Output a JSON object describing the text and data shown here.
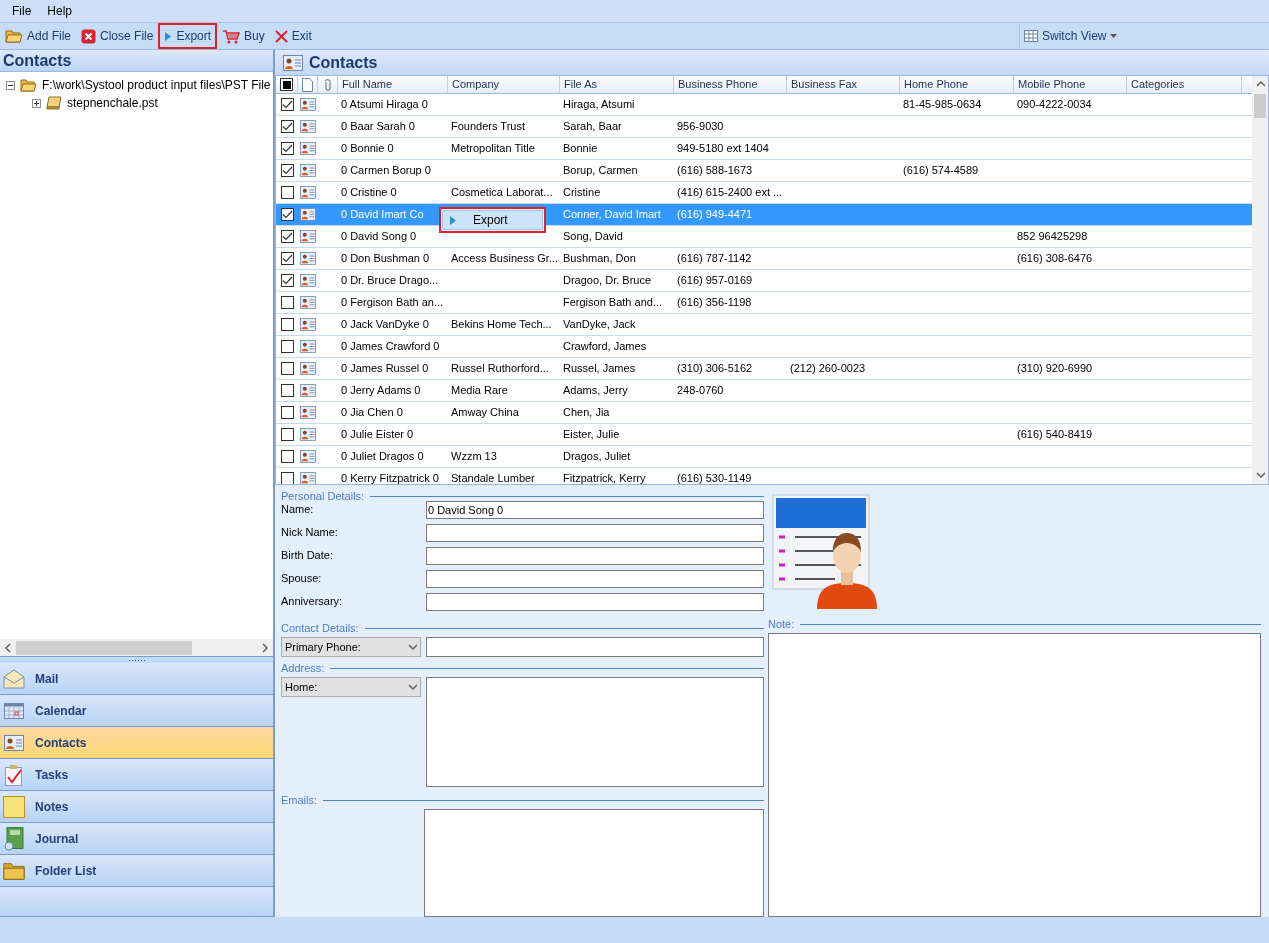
{
  "menu": [
    "File",
    "Help"
  ],
  "toolbar": [
    {
      "kind": "add",
      "label": "Add File",
      "highlighted": false
    },
    {
      "kind": "close",
      "label": "Close File",
      "highlighted": false
    },
    {
      "kind": "export",
      "label": "Export",
      "highlighted": true
    },
    {
      "kind": "buy",
      "label": "Buy",
      "highlighted": false
    },
    {
      "kind": "exit",
      "label": "Exit",
      "highlighted": false
    }
  ],
  "switch_view": "Switch View",
  "left_pane": {
    "title": "Contacts",
    "tree": [
      {
        "label": "F:\\work\\Systool product input files\\PST File",
        "kind": "folder",
        "expanded": true,
        "children": [
          {
            "label": "stepnenchale.pst",
            "kind": "pst",
            "expanded": false
          }
        ]
      }
    ]
  },
  "nav": [
    {
      "label": "Mail",
      "kind": "mail",
      "selected": false
    },
    {
      "label": "Calendar",
      "kind": "calendar",
      "selected": false
    },
    {
      "label": "Contacts",
      "kind": "contacts",
      "selected": true
    },
    {
      "label": "Tasks",
      "kind": "tasks",
      "selected": false
    },
    {
      "label": "Notes",
      "kind": "notes",
      "selected": false
    },
    {
      "label": "Journal",
      "kind": "journal",
      "selected": false
    },
    {
      "label": "Folder List",
      "kind": "folder",
      "selected": false
    }
  ],
  "contacts": {
    "title": "Contacts",
    "select_all_mixed": true,
    "columns": [
      "Full Name",
      "Company",
      "File As",
      "Business Phone",
      "Business Fax",
      "Home Phone",
      "Mobile Phone",
      "Categories"
    ],
    "rows": [
      {
        "checked": true,
        "selected": false,
        "cells": [
          "0 Atsumi Hiraga 0",
          "",
          "Hiraga, Atsumi",
          "",
          "",
          "81-45-985-0634",
          "090-4222-0034",
          ""
        ]
      },
      {
        "checked": true,
        "selected": false,
        "cells": [
          "0 Baar Sarah 0",
          "Founders Trust",
          "Sarah, Baar",
          "956-9030",
          "",
          "",
          "",
          ""
        ]
      },
      {
        "checked": true,
        "selected": false,
        "cells": [
          "0 Bonnie 0",
          "Metropolitan Title",
          "Bonnie",
          "949-5180 ext 1404",
          "",
          "",
          "",
          ""
        ]
      },
      {
        "checked": true,
        "selected": false,
        "cells": [
          "0 Carmen Borup 0",
          "",
          "Borup, Carmen",
          "(616) 588-1673",
          "",
          "(616) 574-4589",
          "",
          ""
        ]
      },
      {
        "checked": false,
        "selected": false,
        "cells": [
          "0 Cristine 0",
          "Cosmetica Laborat...",
          "Cristine",
          "(416) 615-2400 ext ...",
          "",
          "",
          "",
          ""
        ]
      },
      {
        "checked": true,
        "selected": true,
        "cells": [
          "0 David Imart Co",
          "",
          "Conner, David Imart",
          "(616) 949-4471",
          "",
          "",
          "",
          ""
        ]
      },
      {
        "checked": true,
        "selected": false,
        "cells": [
          "0 David Song 0",
          "",
          "Song, David",
          "",
          "",
          "",
          "852 96425298",
          ""
        ]
      },
      {
        "checked": true,
        "selected": false,
        "cells": [
          "0 Don Bushman 0",
          "Access Business Gr...",
          "Bushman, Don",
          "(616) 787-1142",
          "",
          "",
          "(616) 308-6476",
          ""
        ]
      },
      {
        "checked": true,
        "selected": false,
        "cells": [
          "0 Dr. Bruce Drago...",
          "",
          "Dragoo, Dr. Bruce",
          "(616) 957-0169",
          "",
          "",
          "",
          ""
        ]
      },
      {
        "checked": false,
        "selected": false,
        "cells": [
          "0 Fergison Bath an...",
          "",
          "Fergison Bath and...",
          "(616) 356-1198",
          "",
          "",
          "",
          ""
        ]
      },
      {
        "checked": false,
        "selected": false,
        "cells": [
          "0 Jack VanDyke 0",
          "Bekins Home Tech...",
          "VanDyke, Jack",
          "",
          "",
          "",
          "",
          ""
        ]
      },
      {
        "checked": false,
        "selected": false,
        "cells": [
          "0 James Crawford 0",
          "",
          "Crawford, James",
          "",
          "",
          "",
          "",
          ""
        ]
      },
      {
        "checked": false,
        "selected": false,
        "cells": [
          "0 James Russel 0",
          "Russel Ruthorford...",
          "Russel, James",
          "(310) 306-5162",
          "(212) 260-0023",
          "",
          "(310) 920-6990",
          ""
        ]
      },
      {
        "checked": false,
        "selected": false,
        "cells": [
          "0 Jerry Adams 0",
          "Media Rare",
          "Adams, Jerry",
          "248-0760",
          "",
          "",
          "",
          ""
        ]
      },
      {
        "checked": false,
        "selected": false,
        "cells": [
          "0 Jia Chen 0",
          "Amway China",
          "Chen, Jia",
          "",
          "",
          "",
          "",
          ""
        ]
      },
      {
        "checked": false,
        "selected": false,
        "cells": [
          "0 Julie Eister 0",
          "",
          "Eister, Julie",
          "",
          "",
          "",
          "(616) 540-8419",
          ""
        ]
      },
      {
        "checked": false,
        "selected": false,
        "cells": [
          "0 Juliet Dragos 0",
          "Wzzm 13",
          "Dragos, Juliet",
          "",
          "",
          "",
          "",
          ""
        ]
      },
      {
        "checked": false,
        "selected": false,
        "cells": [
          "0 Kerry Fitzpatrick 0",
          "Standale Lumber",
          "Fitzpatrick, Kerry",
          "(616) 530-1149",
          "",
          "",
          "",
          ""
        ]
      }
    ],
    "context_menu": [
      {
        "label": "Export",
        "highlighted": true
      }
    ]
  },
  "details": {
    "personal_title": "Personal Details:",
    "personal_fields": [
      {
        "label": "Name:",
        "value": "0 David Song 0"
      },
      {
        "label": "Nick Name:"
      },
      {
        "label": "Birth Date:"
      },
      {
        "label": "Spouse:"
      },
      {
        "label": "Anniversary:"
      }
    ],
    "contact_title": "Contact Details:",
    "contact_dropdown": "Primary Phone:",
    "address_title": "Address:",
    "address_dropdown": "Home:",
    "emails_title": "Emails:",
    "note_title": "Note:"
  }
}
